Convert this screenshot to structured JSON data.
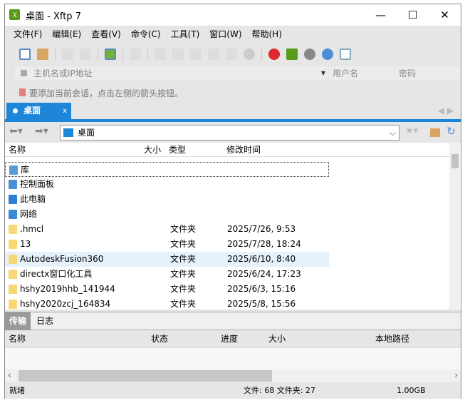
{
  "window": {
    "title": "桌面 - Xftp 7",
    "logo": "xftp",
    "minimize": "—",
    "maximize": "☐",
    "close": "✕"
  },
  "menu": [
    "文件(F)",
    "编辑(E)",
    "查看(V)",
    "命令(C)",
    "工具(T)",
    "窗口(W)",
    "帮助(H)"
  ],
  "connect": {
    "host_placeholder": "主机名或IP地址",
    "user_placeholder": "用户名",
    "password_placeholder": "密码",
    "hint": "要添加当前会话，点击左侧的箭头按钮。"
  },
  "tab": {
    "label": "桌面",
    "close": "x"
  },
  "path": {
    "value": "桌面"
  },
  "file_columns": [
    "名称",
    "大小",
    "类型",
    "修改时间"
  ],
  "files": [
    {
      "name": "库",
      "size": "",
      "type": "",
      "modified": "",
      "icon": "library"
    },
    {
      "name": "控制面板",
      "size": "",
      "type": "",
      "modified": "",
      "icon": "control-panel"
    },
    {
      "name": "此电脑",
      "size": "",
      "type": "",
      "modified": "",
      "icon": "computer"
    },
    {
      "name": "网络",
      "size": "",
      "type": "",
      "modified": "",
      "icon": "network"
    },
    {
      "name": ".hmcl",
      "size": "",
      "type": "文件夹",
      "modified": "2025/7/26, 9:53",
      "icon": "folder"
    },
    {
      "name": "13",
      "size": "",
      "type": "文件夹",
      "modified": "2025/7/28, 18:24",
      "icon": "folder"
    },
    {
      "name": "AutodeskFusion360",
      "size": "",
      "type": "文件夹",
      "modified": "2025/6/10, 8:40",
      "icon": "folder"
    },
    {
      "name": "directx窗口化工具",
      "size": "",
      "type": "文件夹",
      "modified": "2025/6/24, 17:23",
      "icon": "folder"
    },
    {
      "name": "hshy2019hhb_141944",
      "size": "",
      "type": "文件夹",
      "modified": "2025/6/3, 15:16",
      "icon": "folder"
    },
    {
      "name": "hshy2020zcj_164834",
      "size": "",
      "type": "文件夹",
      "modified": "2025/5/8, 15:56",
      "icon": "folder"
    }
  ],
  "bottom_tabs": [
    "传输",
    "日志"
  ],
  "transfer_columns": [
    "名称",
    "状态",
    "进度",
    "大小",
    "本地路径"
  ],
  "status": {
    "left": "就绪",
    "counts": "文件: 68  文件夹: 27",
    "size": "1.00GB"
  }
}
